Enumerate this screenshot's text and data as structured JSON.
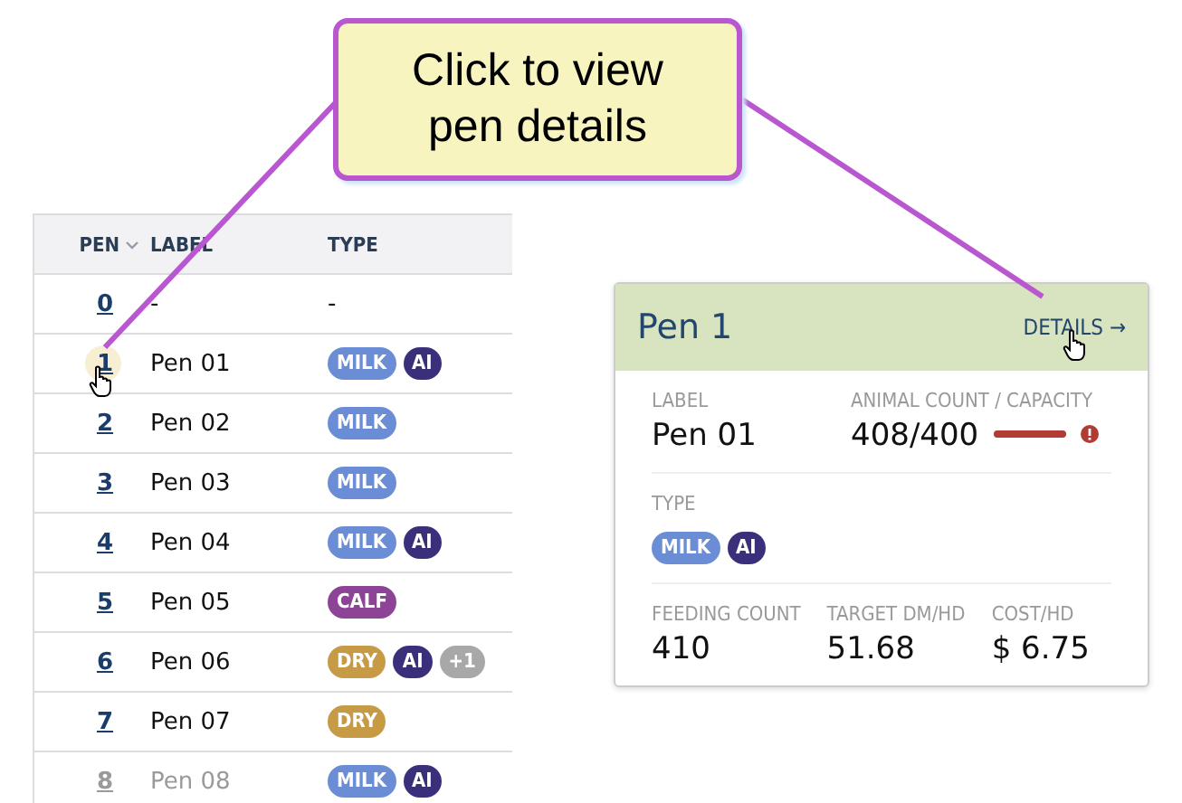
{
  "callout": {
    "text": "Click to view pen details"
  },
  "table": {
    "columns": [
      {
        "label": "PEN",
        "sortable": true
      },
      {
        "label": "LABEL",
        "sortable": false
      },
      {
        "label": "TYPE",
        "sortable": false
      }
    ],
    "rows": [
      {
        "pen": "0",
        "label": "-",
        "type_text": "-",
        "tags": [],
        "selected": false,
        "faded": false
      },
      {
        "pen": "1",
        "label": "Pen 01",
        "tags": [
          {
            "text": "MILK",
            "color": "#6b8dd6"
          },
          {
            "text": "AI",
            "color": "#3a2f7a"
          }
        ],
        "selected": true,
        "faded": false
      },
      {
        "pen": "2",
        "label": "Pen 02",
        "tags": [
          {
            "text": "MILK",
            "color": "#6b8dd6"
          }
        ],
        "selected": false,
        "faded": false
      },
      {
        "pen": "3",
        "label": "Pen 03",
        "tags": [
          {
            "text": "MILK",
            "color": "#6b8dd6"
          }
        ],
        "selected": false,
        "faded": false
      },
      {
        "pen": "4",
        "label": "Pen 04",
        "tags": [
          {
            "text": "MILK",
            "color": "#6b8dd6"
          },
          {
            "text": "AI",
            "color": "#3a2f7a"
          }
        ],
        "selected": false,
        "faded": false
      },
      {
        "pen": "5",
        "label": "Pen 05",
        "tags": [
          {
            "text": "CALF",
            "color": "#8e4496"
          }
        ],
        "selected": false,
        "faded": false
      },
      {
        "pen": "6",
        "label": "Pen 06",
        "tags": [
          {
            "text": "DRY",
            "color": "#c79a45"
          },
          {
            "text": "AI",
            "color": "#3a2f7a"
          },
          {
            "text": "+1",
            "color": "#a8a8a8"
          }
        ],
        "selected": false,
        "faded": false
      },
      {
        "pen": "7",
        "label": "Pen 07",
        "tags": [
          {
            "text": "DRY",
            "color": "#c79a45"
          }
        ],
        "selected": false,
        "faded": false
      },
      {
        "pen": "8",
        "label": "Pen 08",
        "tags": [
          {
            "text": "MILK",
            "color": "#6b8dd6"
          },
          {
            "text": "AI",
            "color": "#3a2f7a"
          }
        ],
        "selected": false,
        "faded": true
      }
    ]
  },
  "card": {
    "title": "Pen 1",
    "details_link": "DETAILS →",
    "label_caption": "LABEL",
    "label_value": "Pen 01",
    "capacity_caption": "ANIMAL COUNT / CAPACITY",
    "capacity_value": "408/400",
    "capacity": {
      "level": 1,
      "alert": true
    },
    "type_caption": "TYPE",
    "tags": [
      {
        "text": "MILK",
        "color": "#6b8dd6"
      },
      {
        "text": "AI",
        "color": "#3a2f7a"
      }
    ],
    "stats": [
      {
        "caption": "FEEDING COUNT",
        "value": "410"
      },
      {
        "caption": "TARGET DM/HD",
        "value": "51.68"
      },
      {
        "caption": "COST/HD",
        "value": "$ 6.75"
      }
    ]
  }
}
